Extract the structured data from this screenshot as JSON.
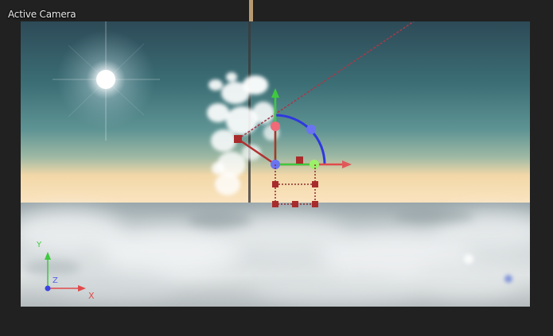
{
  "viewport": {
    "title": "Active Camera"
  },
  "axis_gizmo": {
    "y_label": "Y",
    "z_label": "Z",
    "x_label": "X"
  },
  "colors": {
    "axis_x": "#e14b4b",
    "axis_y": "#3ec93e",
    "axis_z": "#5560e6",
    "panel_background": "#212121"
  }
}
